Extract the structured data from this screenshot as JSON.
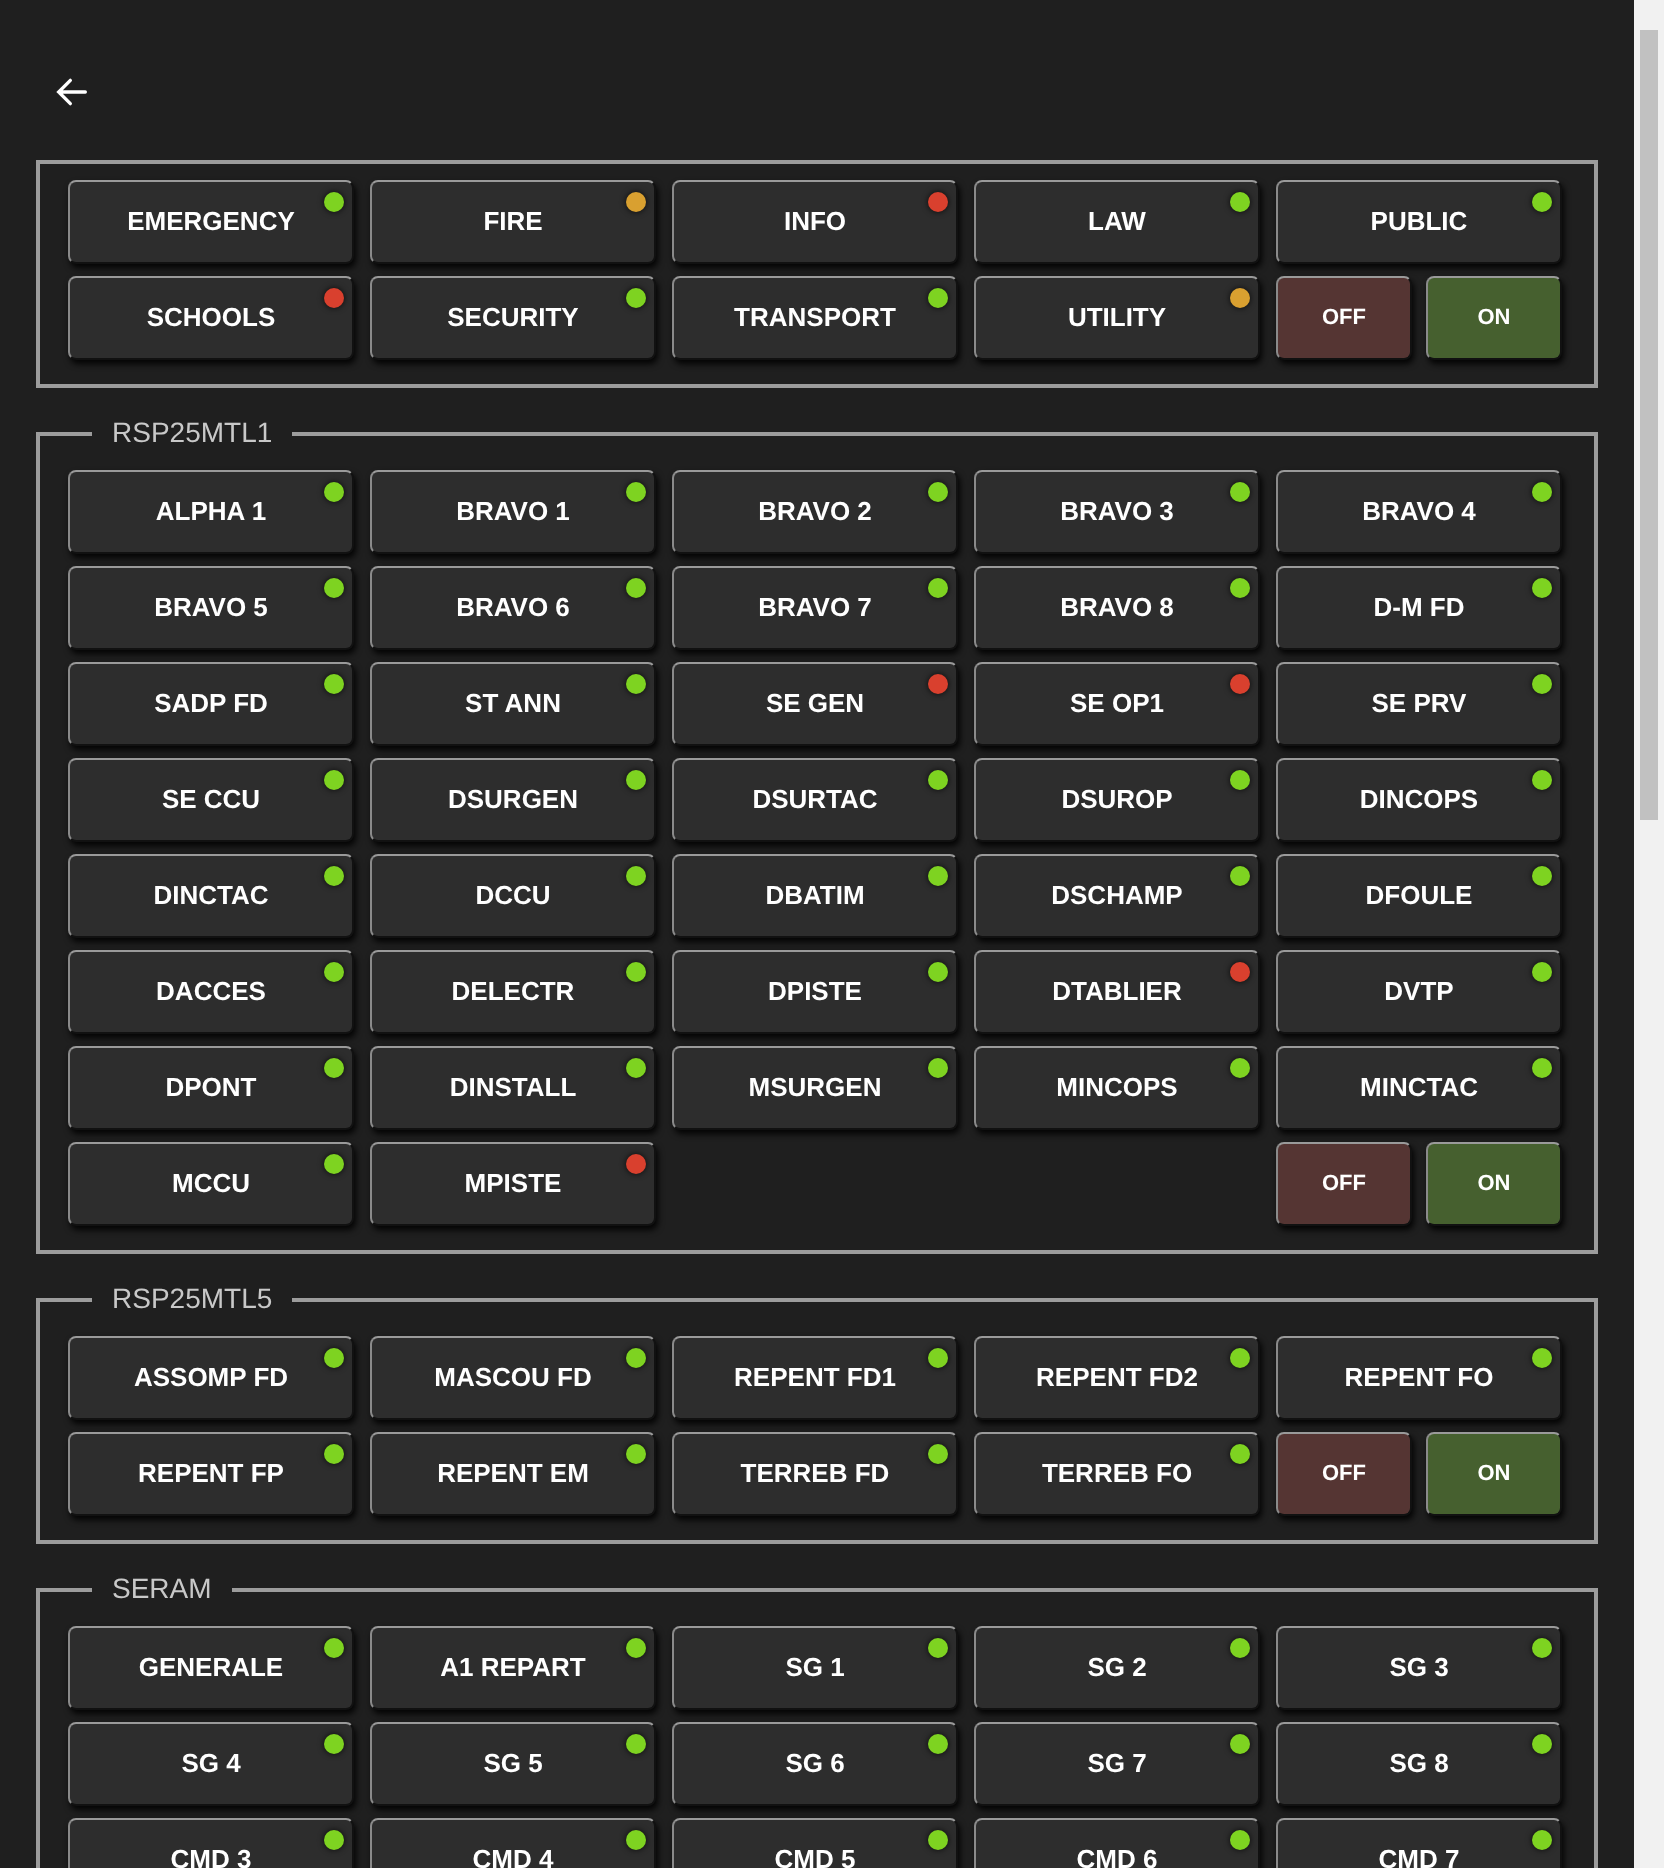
{
  "groups": [
    {
      "items": [
        {
          "kind": "channel",
          "label": "EMERGENCY",
          "color": "#7ed321"
        },
        {
          "kind": "channel",
          "label": "FIRE",
          "color": "#d9a030"
        },
        {
          "kind": "channel",
          "label": "INFO",
          "color": "#d9402e"
        },
        {
          "kind": "channel",
          "label": "LAW",
          "color": "#7ed321"
        },
        {
          "kind": "channel",
          "label": "PUBLIC",
          "color": "#7ed321"
        },
        {
          "kind": "channel",
          "label": "SCHOOLS",
          "color": "#d9402e"
        },
        {
          "kind": "channel",
          "label": "SECURITY",
          "color": "#7ed321"
        },
        {
          "kind": "channel",
          "label": "TRANSPORT",
          "color": "#7ed321"
        },
        {
          "kind": "channel",
          "label": "UTILITY",
          "color": "#d9a030"
        },
        {
          "kind": "switch",
          "off": "OFF",
          "on": "ON"
        }
      ]
    },
    {
      "title": "RSP25MTL1",
      "items": [
        {
          "kind": "channel",
          "label": "ALPHA 1",
          "color": "#7ed321"
        },
        {
          "kind": "channel",
          "label": "BRAVO 1",
          "color": "#7ed321"
        },
        {
          "kind": "channel",
          "label": "BRAVO 2",
          "color": "#7ed321"
        },
        {
          "kind": "channel",
          "label": "BRAVO 3",
          "color": "#7ed321"
        },
        {
          "kind": "channel",
          "label": "BRAVO 4",
          "color": "#7ed321"
        },
        {
          "kind": "channel",
          "label": "BRAVO 5",
          "color": "#7ed321"
        },
        {
          "kind": "channel",
          "label": "BRAVO 6",
          "color": "#7ed321"
        },
        {
          "kind": "channel",
          "label": "BRAVO 7",
          "color": "#7ed321"
        },
        {
          "kind": "channel",
          "label": "BRAVO 8",
          "color": "#7ed321"
        },
        {
          "kind": "channel",
          "label": "D-M FD",
          "color": "#7ed321"
        },
        {
          "kind": "channel",
          "label": "SADP FD",
          "color": "#7ed321"
        },
        {
          "kind": "channel",
          "label": "ST ANN",
          "color": "#7ed321"
        },
        {
          "kind": "channel",
          "label": "SE GEN",
          "color": "#d9402e"
        },
        {
          "kind": "channel",
          "label": "SE OP1",
          "color": "#d9402e"
        },
        {
          "kind": "channel",
          "label": "SE PRV",
          "color": "#7ed321"
        },
        {
          "kind": "channel",
          "label": "SE CCU",
          "color": "#7ed321"
        },
        {
          "kind": "channel",
          "label": "DSURGEN",
          "color": "#7ed321"
        },
        {
          "kind": "channel",
          "label": "DSURTAC",
          "color": "#7ed321"
        },
        {
          "kind": "channel",
          "label": "DSUROP",
          "color": "#7ed321"
        },
        {
          "kind": "channel",
          "label": "DINCOPS",
          "color": "#7ed321"
        },
        {
          "kind": "channel",
          "label": "DINCTAC",
          "color": "#7ed321"
        },
        {
          "kind": "channel",
          "label": "DCCU",
          "color": "#7ed321"
        },
        {
          "kind": "channel",
          "label": "DBATIM",
          "color": "#7ed321"
        },
        {
          "kind": "channel",
          "label": "DSCHAMP",
          "color": "#7ed321"
        },
        {
          "kind": "channel",
          "label": "DFOULE",
          "color": "#7ed321"
        },
        {
          "kind": "channel",
          "label": "DACCES",
          "color": "#7ed321"
        },
        {
          "kind": "channel",
          "label": "DELECTR",
          "color": "#7ed321"
        },
        {
          "kind": "channel",
          "label": "DPISTE",
          "color": "#7ed321"
        },
        {
          "kind": "channel",
          "label": "DTABLIER",
          "color": "#d9402e"
        },
        {
          "kind": "channel",
          "label": "DVTP",
          "color": "#7ed321"
        },
        {
          "kind": "channel",
          "label": "DPONT",
          "color": "#7ed321"
        },
        {
          "kind": "channel",
          "label": "DINSTALL",
          "color": "#7ed321"
        },
        {
          "kind": "channel",
          "label": "MSURGEN",
          "color": "#7ed321"
        },
        {
          "kind": "channel",
          "label": "MINCOPS",
          "color": "#7ed321"
        },
        {
          "kind": "channel",
          "label": "MINCTAC",
          "color": "#7ed321"
        },
        {
          "kind": "channel",
          "label": "MCCU",
          "color": "#7ed321"
        },
        {
          "kind": "channel",
          "label": "MPISTE",
          "color": "#d9402e"
        },
        {
          "kind": "switch",
          "off": "OFF",
          "on": "ON"
        }
      ]
    },
    {
      "title": "RSP25MTL5",
      "items": [
        {
          "kind": "channel",
          "label": "ASSOMP FD",
          "color": "#7ed321"
        },
        {
          "kind": "channel",
          "label": "MASCOU FD",
          "color": "#7ed321"
        },
        {
          "kind": "channel",
          "label": "REPENT FD1",
          "color": "#7ed321"
        },
        {
          "kind": "channel",
          "label": "REPENT FD2",
          "color": "#7ed321"
        },
        {
          "kind": "channel",
          "label": "REPENT FO",
          "color": "#7ed321"
        },
        {
          "kind": "channel",
          "label": "REPENT FP",
          "color": "#7ed321"
        },
        {
          "kind": "channel",
          "label": "REPENT EM",
          "color": "#7ed321"
        },
        {
          "kind": "channel",
          "label": "TERREB FD",
          "color": "#7ed321"
        },
        {
          "kind": "channel",
          "label": "TERREB FO",
          "color": "#7ed321"
        },
        {
          "kind": "switch",
          "off": "OFF",
          "on": "ON"
        }
      ]
    },
    {
      "title": "SERAM",
      "items": [
        {
          "kind": "channel",
          "label": "GENERALE",
          "color": "#7ed321"
        },
        {
          "kind": "channel",
          "label": "A1 REPART",
          "color": "#7ed321"
        },
        {
          "kind": "channel",
          "label": "SG 1",
          "color": "#7ed321"
        },
        {
          "kind": "channel",
          "label": "SG 2",
          "color": "#7ed321"
        },
        {
          "kind": "channel",
          "label": "SG 3",
          "color": "#7ed321"
        },
        {
          "kind": "channel",
          "label": "SG 4",
          "color": "#7ed321"
        },
        {
          "kind": "channel",
          "label": "SG 5",
          "color": "#7ed321"
        },
        {
          "kind": "channel",
          "label": "SG 6",
          "color": "#7ed321"
        },
        {
          "kind": "channel",
          "label": "SG 7",
          "color": "#7ed321"
        },
        {
          "kind": "channel",
          "label": "SG 8",
          "color": "#7ed321"
        },
        {
          "kind": "channel",
          "label": "CMD 3",
          "color": "#7ed321"
        },
        {
          "kind": "channel",
          "label": "CMD 4",
          "color": "#7ed321"
        },
        {
          "kind": "channel",
          "label": "CMD 5",
          "color": "#7ed321"
        },
        {
          "kind": "channel",
          "label": "CMD 6",
          "color": "#7ed321"
        },
        {
          "kind": "channel",
          "label": "CMD 7",
          "color": "#7ed321"
        }
      ]
    }
  ]
}
